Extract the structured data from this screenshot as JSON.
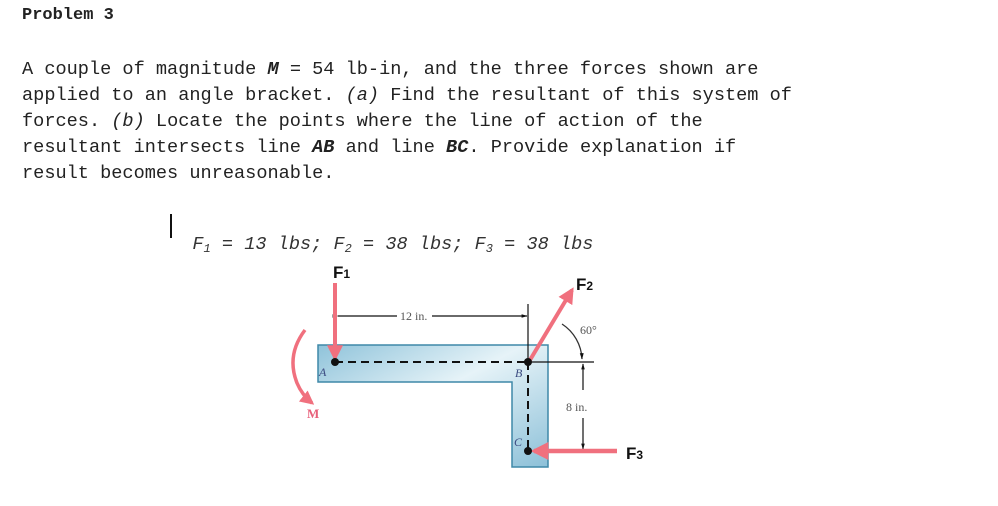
{
  "problem": {
    "title": "Problem 3",
    "lines": [
      {
        "parts": [
          {
            "t": "A couple of magnitude "
          },
          {
            "t": "M",
            "style": "bi"
          },
          {
            "t": " = 54 lb-in, and the three forces shown are"
          }
        ]
      },
      {
        "parts": [
          {
            "t": "applied to an angle bracket. "
          },
          {
            "t": "(a)",
            "style": "i"
          },
          {
            "t": " Find the resultant of this system of"
          }
        ]
      },
      {
        "parts": [
          {
            "t": "forces. "
          },
          {
            "t": "(b)",
            "style": "i"
          },
          {
            "t": " Locate the points where the line of action of the"
          }
        ]
      },
      {
        "parts": [
          {
            "t": "resultant intersects line "
          },
          {
            "t": "AB",
            "style": "bi"
          },
          {
            "t": " and line "
          },
          {
            "t": "BC",
            "style": "bi"
          },
          {
            "t": ". Provide explanation if"
          }
        ]
      },
      {
        "parts": [
          {
            "t": "result becomes unreasonable."
          }
        ]
      }
    ],
    "given": [
      {
        "name": "F",
        "sub": "1",
        "value": "13 lbs"
      },
      {
        "name": "F",
        "sub": "2",
        "value": "38 lbs"
      },
      {
        "name": "F",
        "sub": "3",
        "value": "38 lbs"
      }
    ]
  },
  "figure": {
    "labels": {
      "f1": "F",
      "f1_sub": "1",
      "f2": "F",
      "f2_sub": "2",
      "f3": "F",
      "f3_sub": "3",
      "moment": "M",
      "point_a": "A",
      "point_b": "B",
      "point_c": "C",
      "dim_ab": "12 in.",
      "dim_bc": "8 in.",
      "angle": "60°"
    },
    "colors": {
      "force": "#f0707e",
      "bracket_fill": "#a9d2e3",
      "bracket_edge": "#3f88a8",
      "dim_line": "#111111"
    }
  }
}
